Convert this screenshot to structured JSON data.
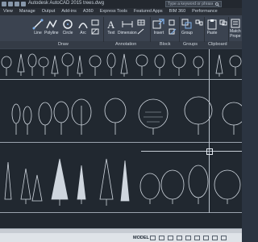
{
  "titlebar": {
    "title": "Autodesk AutoCAD 2015    trees.dwg",
    "search_placeholder": "Type a keyword or phrase"
  },
  "menu_tabs": [
    "View",
    "Manage",
    "Output",
    "Add-ins",
    "A360",
    "Express Tools",
    "Featured Apps",
    "BIM 360",
    "Performance"
  ],
  "ribbon": {
    "draw_tools": [
      "Line",
      "Polyline",
      "Circle",
      "Arc"
    ],
    "annotation_tools": [
      "Text",
      "Dimension"
    ],
    "block_tools": [
      "Insert"
    ],
    "group_tools": [
      "Group"
    ],
    "clipboard_tools": [
      "Paste"
    ],
    "extra_tools": [
      "Match",
      "Prope"
    ],
    "panels": {
      "draw": "Draw",
      "annotation": "Annotation",
      "block": "Block",
      "groups": "Groups",
      "clipboard": "Clipboard"
    }
  },
  "status": {
    "model_label": "MODEL"
  },
  "colors": {
    "canvas": "#212830",
    "ribbon": "#3b4350",
    "statusbar": "#dfe3e8",
    "lines": "#c0c8d0"
  }
}
